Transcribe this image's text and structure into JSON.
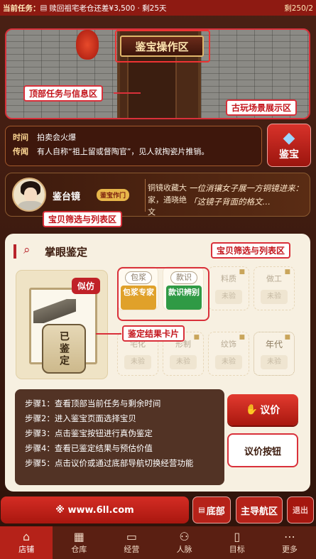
{
  "topbar": {
    "task_label": "当前任务：",
    "task_icon": "book-icon",
    "task_text": "赎回祖宅老仓还差¥3,500 · 剩25天",
    "remaining": "剩250/2"
  },
  "scene": {
    "plaque": "鉴宝操作区",
    "anno_top": "顶部任务与信息区",
    "anno_scene": "古玩场景展示区"
  },
  "info": {
    "time_key": "时间",
    "time_val": "拍卖会火爆",
    "rumor_key": "传闻",
    "rumor_val": "有人自称“祖上留或督陶官”，见人就掏瓷片推销。"
  },
  "appraise_button": {
    "label": "鉴宝",
    "icon": "diamond-icon"
  },
  "character": {
    "name": "鉴台镜",
    "tag": "鉴宝作门",
    "quote": "铜镜收藏大家，通晓绝文",
    "speech": "一位消镶女子展一方铜镜进来：「这镜子背面的格文…"
  },
  "anno_filter_top": "宝贝筛选与列表区",
  "panel": {
    "title": "掌眼鉴定",
    "anno_filter": "宝贝筛选与列表区",
    "anno_result": "鉴定结果卡片",
    "item": {
      "badge": "似仿",
      "stamp": "已鉴定"
    },
    "grid": [
      {
        "t": "包浆",
        "s": "包浆专家",
        "state": "gold"
      },
      {
        "t": "款识",
        "s": "款识辨别",
        "state": "green"
      },
      {
        "t": "料质",
        "s": "未验",
        "state": "locked"
      },
      {
        "t": "做工",
        "s": "未验",
        "state": "locked"
      },
      {
        "t": "宅化",
        "s": "未验",
        "state": "locked"
      },
      {
        "t": "形制",
        "s": "未验",
        "state": "locked"
      },
      {
        "t": "纹饰",
        "s": "未验",
        "state": "locked"
      },
      {
        "t": "年代",
        "s": "未验",
        "state": "dotted"
      }
    ],
    "steps": [
      "步骤1：查看顶部当前任务与剩余时间",
      "步骤2：进入鉴宝页面选择宝贝",
      "步骤3：点击鉴宝按钮进行真伪鉴定",
      "步骤4：查看已鉴定结果与预估价值",
      "步骤5：点击议价或通过底部导航切换经营功能"
    ],
    "price_button": "议价",
    "price_outline": "议价按钮"
  },
  "bottom": {
    "url": "※ www.6ll.com",
    "btn1": "底部",
    "btn2": "主导航区",
    "btn3": "退出"
  },
  "nav": [
    {
      "label": "店铺",
      "icon": "shop-icon"
    },
    {
      "label": "仓库",
      "icon": "warehouse-icon"
    },
    {
      "label": "经营",
      "icon": "ledger-icon"
    },
    {
      "label": "人脉",
      "icon": "people-icon"
    },
    {
      "label": "目标",
      "icon": "target-icon"
    },
    {
      "label": "更多",
      "icon": "more-icon"
    }
  ],
  "colors": {
    "accent": "#b8232a",
    "gold": "#e0a12a",
    "green": "#2f9a45",
    "panel_bg": "#f7f0e1"
  }
}
